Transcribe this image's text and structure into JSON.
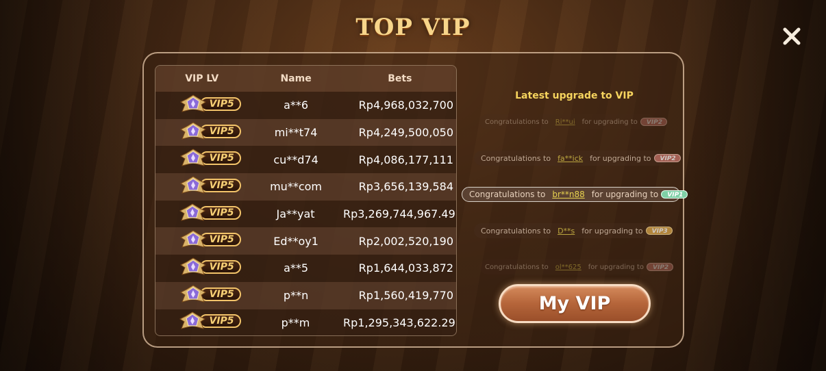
{
  "title": "TOP VIP",
  "close_icon": "close-icon",
  "table": {
    "headers": {
      "vip_lv": "VIP LV",
      "name": "Name",
      "bets": "Bets"
    },
    "rows": [
      {
        "vip": "VIP5",
        "name": "a**6",
        "bets": "Rp4,968,032,700"
      },
      {
        "vip": "VIP5",
        "name": "mi**t74",
        "bets": "Rp4,249,500,050"
      },
      {
        "vip": "VIP5",
        "name": "cu**d74",
        "bets": "Rp4,086,177,111"
      },
      {
        "vip": "VIP5",
        "name": "mu**com",
        "bets": "Rp3,656,139,584"
      },
      {
        "vip": "VIP5",
        "name": "Ja**yat",
        "bets": "Rp3,269,744,967.49"
      },
      {
        "vip": "VIP5",
        "name": "Ed**oy1",
        "bets": "Rp2,002,520,190"
      },
      {
        "vip": "VIP5",
        "name": "a**5",
        "bets": "Rp1,644,033,872"
      },
      {
        "vip": "VIP5",
        "name": "p**n",
        "bets": "Rp1,560,419,770"
      },
      {
        "vip": "VIP5",
        "name": "p**m",
        "bets": "Rp1,295,343,622.29"
      }
    ]
  },
  "upgrades": {
    "title": "Latest upgrade to VIP",
    "items": [
      {
        "prefix": "Congratulations to",
        "user": "Ri**ui",
        "suffix": "for upgrading to",
        "level": "VIP2",
        "color": "#c7746a"
      },
      {
        "prefix": "Congratulations to",
        "user": "fa**ick",
        "suffix": "for upgrading to",
        "level": "VIP2",
        "color": "#c7746a"
      },
      {
        "prefix": "Congratulations to",
        "user": "br**n88",
        "suffix": "for upgrading to",
        "level": "VIP1",
        "color": "#7fd0a6"
      },
      {
        "prefix": "Congratulations to",
        "user": "D**s",
        "suffix": "for upgrading to",
        "level": "VIP3",
        "color": "#d8a64a"
      },
      {
        "prefix": "Congratulations to",
        "user": "ol**625",
        "suffix": "for upgrading to",
        "level": "VIP2",
        "color": "#c7746a"
      }
    ]
  },
  "my_vip_label": "My VIP",
  "colors": {
    "title": "#f7d58a",
    "accent_gold": "#f6d45e",
    "button": "#b5653a"
  }
}
